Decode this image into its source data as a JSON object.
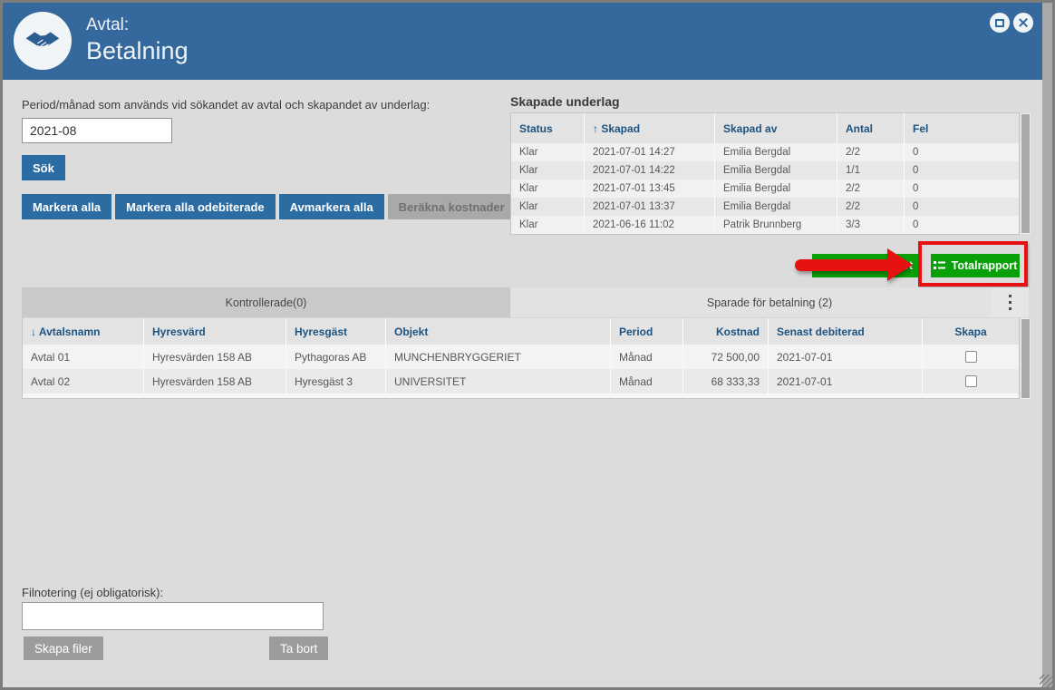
{
  "colors": {
    "header_blue": "#35689c",
    "button_blue": "#2b6ca3",
    "green": "#0aa00a",
    "annotation_red": "#e81111",
    "table_header_text": "#1d5380"
  },
  "window": {
    "title_line1": "Avtal:",
    "title_line2": "Betalning"
  },
  "search_panel": {
    "period_label": "Period/månad som används vid sökandet av avtal och skapandet av underlag:",
    "period_value": "2021-08",
    "sok_label": "Sök",
    "buttons": [
      {
        "label": "Markera alla"
      },
      {
        "label": "Markera alla odebiterade"
      },
      {
        "label": "Avmarkera alla"
      },
      {
        "label": "Beräkna kostnader"
      }
    ]
  },
  "skapade_underlag": {
    "title": "Skapade underlag",
    "columns": [
      "Status",
      "↑ Skapad",
      "Skapad av",
      "Antal",
      "Fel"
    ],
    "rows": [
      [
        "Klar",
        "2021-07-01 14:27",
        "Emilia Bergdal",
        "2/2",
        "0"
      ],
      [
        "Klar",
        "2021-07-01 14:22",
        "Emilia Bergdal",
        "1/1",
        "0"
      ],
      [
        "Klar",
        "2021-07-01 13:45",
        "Emilia Bergdal",
        "2/2",
        "0"
      ],
      [
        "Klar",
        "2021-07-01 13:37",
        "Emilia Bergdal",
        "2/2",
        "0"
      ],
      [
        "Klar",
        "2021-06-16 11:02",
        "Patrik Brunnberg",
        "3/3",
        "0"
      ]
    ]
  },
  "report_buttons": {
    "partial_visible_label": "rt",
    "total_label": "Totalrapport"
  },
  "tabs": [
    {
      "label": "Kontrollerade(0)"
    },
    {
      "label": "Sparade för betalning (2)"
    }
  ],
  "main_table": {
    "columns": [
      "↓ Avtalsnamn",
      "Hyresvärd",
      "Hyresgäst",
      "Objekt",
      "Period",
      "Kostnad",
      "Senast debiterad",
      "Skapa"
    ],
    "rows": [
      [
        "Avtal 01",
        "Hyresvärden 158 AB",
        "Pythagoras AB",
        "MUNCHENBRYGGERIET",
        "Månad",
        "72 500,00",
        "2021-07-01"
      ],
      [
        "Avtal 02",
        "Hyresvärden 158 AB",
        "Hyresgäst 3",
        "UNIVERSITET",
        "Månad",
        "68 333,33",
        "2021-07-01"
      ]
    ]
  },
  "footer": {
    "filnotering_label": "Filnotering (ej obligatorisk):",
    "filnotering_value": "",
    "skapa_filer_label": "Skapa filer",
    "ta_bort_label": "Ta bort"
  }
}
